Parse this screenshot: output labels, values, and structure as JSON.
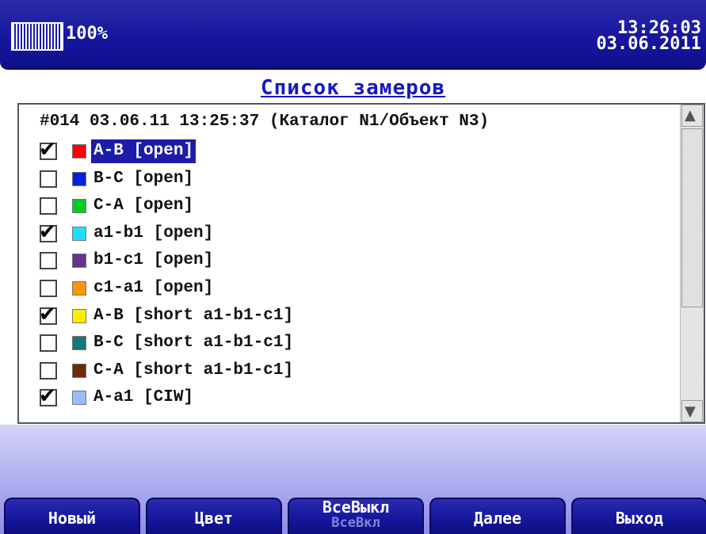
{
  "status": {
    "battery_percent": "100%",
    "time": "13:26:03",
    "date": "03.06.2011"
  },
  "title": "Список замеров",
  "list": {
    "header": "#014 03.06.11 13:25:37 (Каталог N1/Объект N3)",
    "items": [
      {
        "label": "A-B [open]",
        "checked": true,
        "color": "#ff0000",
        "selected": true
      },
      {
        "label": "B-C [open]",
        "checked": false,
        "color": "#0022dd",
        "selected": false
      },
      {
        "label": "C-A [open]",
        "checked": false,
        "color": "#00cc22",
        "selected": false
      },
      {
        "label": "a1-b1 [open]",
        "checked": true,
        "color": "#22ddff",
        "selected": false
      },
      {
        "label": "b1-c1 [open]",
        "checked": false,
        "color": "#66338f",
        "selected": false
      },
      {
        "label": "c1-a1 [open]",
        "checked": false,
        "color": "#ff9500",
        "selected": false
      },
      {
        "label": "A-B [short a1-b1-c1]",
        "checked": true,
        "color": "#ffee00",
        "selected": false
      },
      {
        "label": "B-C [short a1-b1-c1]",
        "checked": false,
        "color": "#11777a",
        "selected": false
      },
      {
        "label": "C-A [short a1-b1-c1]",
        "checked": false,
        "color": "#6b2a0c",
        "selected": false
      },
      {
        "label": "A-a1 [CIW]",
        "checked": true,
        "color": "#99bbff",
        "selected": false
      }
    ]
  },
  "buttons": {
    "new": "Новый",
    "color": "Цвет",
    "all_off": "ВсеВыкл",
    "all_on": "ВсеВкл",
    "next": "Далее",
    "exit": "Выход"
  }
}
